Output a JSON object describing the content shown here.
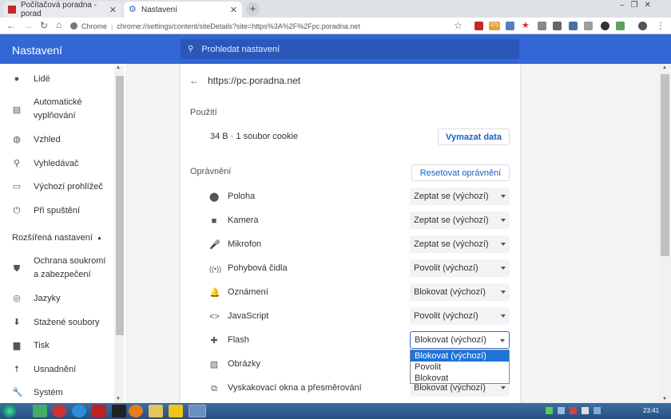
{
  "browser": {
    "tabs": [
      {
        "title": "Počítačová poradna - porad",
        "active": false
      },
      {
        "title": "Nastavení",
        "active": true
      }
    ],
    "omnibox": {
      "scheme_label": "Chrome",
      "url": "chrome://settings/content/siteDetails?site=https%3A%2F%2Fpc.poradna.net"
    },
    "badge_count": "271"
  },
  "header": {
    "title": "Nastavení",
    "search_placeholder": "Prohledat nastavení"
  },
  "sidebar": {
    "items": [
      {
        "label": "Lidé",
        "icon": "person-icon"
      },
      {
        "label": "Automatické",
        "label2": "vyplňování",
        "icon": "clipboard-icon"
      },
      {
        "label": "Vzhled",
        "icon": "palette-icon"
      },
      {
        "label": "Vyhledávač",
        "icon": "search-icon"
      },
      {
        "label": "Výchozí prohlížeč",
        "icon": "browser-icon"
      },
      {
        "label": "Při spuštění",
        "icon": "power-icon"
      }
    ],
    "advanced_label": "Rozšířená nastavení",
    "advanced_items": [
      {
        "label": "Ochrana soukromí",
        "label2": "a zabezpečení",
        "icon": "shield-icon"
      },
      {
        "label": "Jazyky",
        "icon": "globe-icon"
      },
      {
        "label": "Stažené soubory",
        "icon": "download-icon"
      },
      {
        "label": "Tisk",
        "icon": "print-icon"
      },
      {
        "label": "Usnadnění",
        "icon": "accessibility-icon"
      },
      {
        "label": "Systém",
        "icon": "wrench-icon"
      }
    ]
  },
  "site": {
    "back_label": "←",
    "url": "https://pc.poradna.net",
    "usage_title": "Použití",
    "usage_text": "34 B · 1 soubor cookie",
    "clear_button": "Vymazat data",
    "permissions_title": "Oprávnění",
    "reset_button": "Resetovat oprávnění",
    "permissions": [
      {
        "label": "Poloha",
        "value": "Zeptat se (výchozí)",
        "icon": "location-icon"
      },
      {
        "label": "Kamera",
        "value": "Zeptat se (výchozí)",
        "icon": "camera-icon"
      },
      {
        "label": "Mikrofon",
        "value": "Zeptat se (výchozí)",
        "icon": "microphone-icon"
      },
      {
        "label": "Pohybová čidla",
        "value": "Povolit (výchozí)",
        "icon": "sensors-icon"
      },
      {
        "label": "Oznámení",
        "value": "Blokovat (výchozí)",
        "icon": "bell-icon"
      },
      {
        "label": "JavaScript",
        "value": "Povolit (výchozí)",
        "icon": "code-icon"
      },
      {
        "label": "Flash",
        "value": "Blokovat (výchozí)",
        "icon": "puzzle-icon"
      },
      {
        "label": "Obrázky",
        "value": "",
        "icon": "image-icon"
      },
      {
        "label": "Vyskakovací okna a přesměrování",
        "value": "Blokovat (výchozí)",
        "icon": "popup-icon"
      }
    ],
    "flash_dropdown_options": [
      "Blokovat (výchozí)",
      "Povolit",
      "Blokovat"
    ]
  },
  "taskbar": {
    "clock": "23:41"
  },
  "colors": {
    "header": "#3367d6",
    "accent": "#1a5fc9",
    "dropdown_selected": "#1e73d8"
  }
}
